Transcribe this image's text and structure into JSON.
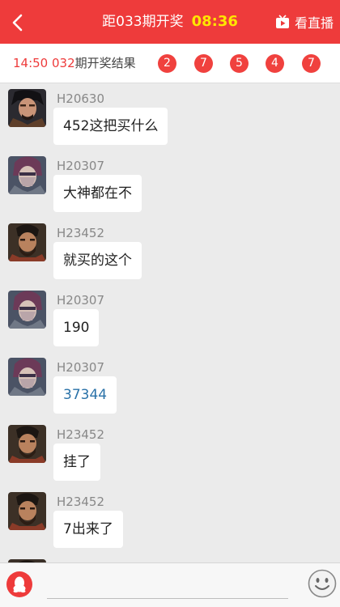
{
  "header": {
    "title": "距033期开奖",
    "countdown": "08:36",
    "live_label": "看直播"
  },
  "result": {
    "time": "14:50",
    "issue": "032",
    "label": "期开奖结果",
    "balls": [
      "2",
      "7",
      "5",
      "4",
      "7"
    ]
  },
  "messages": [
    {
      "sender": "H20630",
      "text": "452这把买什么",
      "avatar": "avatar-dark-warrior"
    },
    {
      "sender": "H20307",
      "text": "大神都在不",
      "avatar": "avatar-masked-warrior"
    },
    {
      "sender": "H23452",
      "text": "就买的这个",
      "avatar": "avatar-bearded-warrior"
    },
    {
      "sender": "H20307",
      "text": "190",
      "avatar": "avatar-masked-warrior"
    },
    {
      "sender": "H20307",
      "text": "37344",
      "avatar": "avatar-masked-warrior"
    },
    {
      "sender": "H23452",
      "text": "挂了",
      "avatar": "avatar-bearded-warrior"
    },
    {
      "sender": "H23452",
      "text": "7出来了",
      "avatar": "avatar-bearded-warrior"
    }
  ],
  "input": {
    "value": "",
    "placeholder": ""
  },
  "colors": {
    "brand_red": "#ee3b3b",
    "countdown_yellow": "#ffe600",
    "ball_red": "#f0413e",
    "link_blue": "#2a72a8"
  }
}
